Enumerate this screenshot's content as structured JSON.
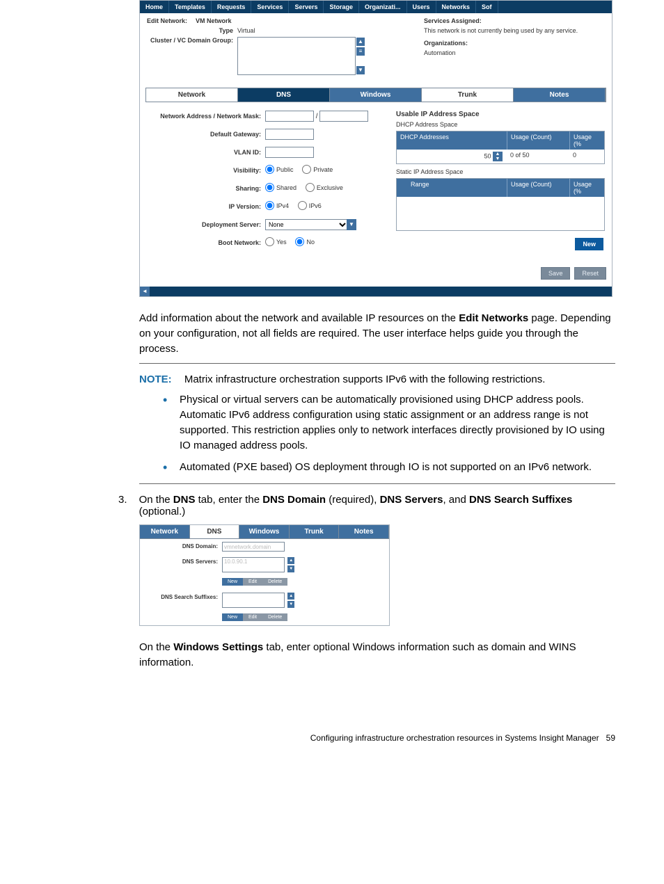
{
  "topnav": [
    "Home",
    "Templates",
    "Requests",
    "Services",
    "Servers",
    "Storage",
    "Organizati...",
    "Users",
    "Networks",
    "Sof"
  ],
  "edit_network": {
    "title_label": "Edit Network:",
    "title_value": "VM Network",
    "type_label": "Type",
    "type_value": "Virtual",
    "cluster_label": "Cluster / VC Domain Group:",
    "services_assigned_label": "Services Assigned:",
    "services_assigned_value": "This network is not currently being used by any service.",
    "orgs_label": "Organizations:",
    "orgs_value": "Automation"
  },
  "subtabs": {
    "network": "Network",
    "dns": "DNS",
    "windows": "Windows",
    "trunk": "Trunk",
    "notes": "Notes"
  },
  "netform": {
    "net_mask_label": "Network Address / Network Mask:",
    "net_mask_val1": "",
    "net_mask_val2": "",
    "default_gw_label": "Default Gateway:",
    "default_gw_val": "",
    "vlan_label": "VLAN ID:",
    "visibility_label": "Visibility:",
    "vis_public": "Public",
    "vis_private": "Private",
    "sharing_label": "Sharing:",
    "sh_shared": "Shared",
    "sh_exclusive": "Exclusive",
    "ipver_label": "IP Version:",
    "ipv4": "IPv4",
    "ipv6": "IPv6",
    "deploy_label": "Deployment Server:",
    "deploy_value": "None",
    "boot_label": "Boot Network:",
    "boot_yes": "Yes",
    "boot_no": "No"
  },
  "ip_space": {
    "title": "Usable IP Address Space",
    "dhcp_title": "DHCP Address Space",
    "dhcp_col1": "DHCP Addresses",
    "col_usage_count": "Usage (Count)",
    "col_usage_pct": "Usage (%",
    "dhcp_val": "50",
    "dhcp_count": "0 of 50",
    "dhcp_pct": "0",
    "static_title": "Static IP Address Space",
    "static_col1": "Range",
    "new_label": "New"
  },
  "footer_buttons": {
    "save": "Save",
    "reset": "Reset"
  },
  "body": {
    "p1_a": "Add information about the network and available IP resources on the ",
    "p1_b": "Edit Networks",
    "p1_c": " page. Depending on your configuration, not all fields are required. The user interface helps guide you through the process.",
    "note_kw": "NOTE:",
    "note_text": "Matrix infrastructure orchestration supports IPv6 with the following restrictions.",
    "bullet1": "Physical or virtual servers can be automatically provisioned using DHCP address pools. Automatic IPv6 address configuration using static assignment or an address range is not supported. This restriction applies only to network interfaces directly provisioned by IO using IO managed address pools.",
    "bullet2": "Automated (PXE based) OS deployment through IO is not supported on an IPv6 network.",
    "step3_num": "3.",
    "step3_a": "On the ",
    "step3_b": "DNS",
    "step3_c": " tab, enter the ",
    "step3_d": "DNS Domain",
    "step3_e": " (required), ",
    "step3_f": "DNS Servers",
    "step3_g": ", and ",
    "step3_h": "DNS Search Suffixes",
    "step3_i": " (optional.)",
    "p2_a": "On the ",
    "p2_b": "Windows Settings",
    "p2_c": " tab, enter optional Windows information such as domain and WINS information."
  },
  "shot2": {
    "dns_domain_label": "DNS Domain:",
    "dns_domain_val": "vmnetwork.domain",
    "dns_servers_label": "DNS Servers:",
    "dns_servers_val": "10.0.90.1",
    "dns_suffix_label": "DNS Search Suffixes:",
    "btn_new": "New",
    "btn_edit": "Edit",
    "btn_delete": "Delete"
  },
  "page_footer": {
    "text": "Configuring infrastructure orchestration resources in Systems Insight Manager",
    "num": "59"
  }
}
